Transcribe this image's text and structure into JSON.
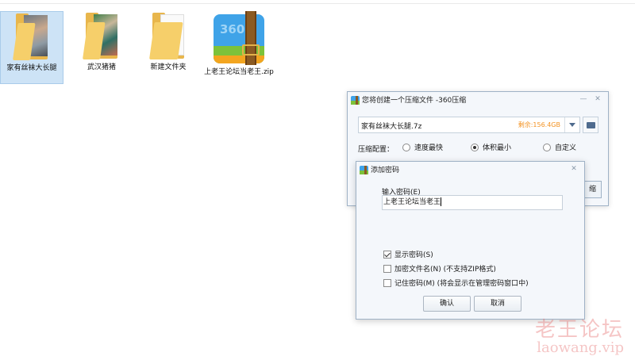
{
  "desktop": {
    "items": [
      {
        "label": "家有丝袜大长腿"
      },
      {
        "label": "武汉猪猪"
      },
      {
        "label": "新建文件夹"
      },
      {
        "label": "上老王论坛当老王.zip"
      }
    ]
  },
  "compress_dialog": {
    "title": "您将创建一个压缩文件 -360压缩",
    "file_name": "家有丝袜大长腿.7z",
    "space_remaining": "剩余:156.4GB",
    "config_label": "压缩配置：",
    "options": [
      {
        "label": "速度最快",
        "selected": false
      },
      {
        "label": "体积最小",
        "selected": true
      },
      {
        "label": "自定义",
        "selected": false
      }
    ],
    "hidden_button_fragment": "缩"
  },
  "password_dialog": {
    "title": "添加密码",
    "input_label": "输入密码(E)",
    "password_value": "上老王论坛当老王",
    "checkboxes": [
      {
        "label": "显示密码(S)",
        "checked": true
      },
      {
        "label": "加密文件名(N) (不支持ZIP格式)",
        "checked": false
      },
      {
        "label": "记住密码(M) (将会显示在管理密码窗口中)",
        "checked": false
      }
    ],
    "ok_label": "确认",
    "cancel_label": "取消"
  },
  "window_controls": {
    "minimize": "—",
    "close": "✕"
  },
  "watermark": {
    "cn": "老王论坛",
    "url": "laowang.vip"
  },
  "colors": {
    "accent_orange": "#f39323",
    "dialog_bg": "#f4f7fb",
    "selection": "#cde3f6"
  }
}
